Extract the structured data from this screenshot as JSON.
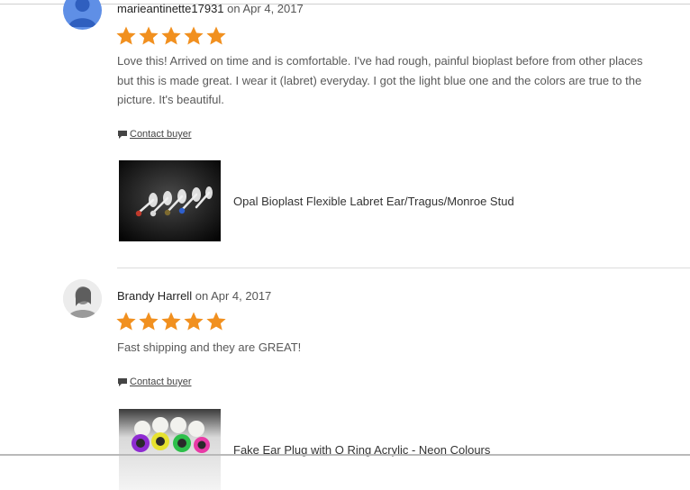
{
  "colors": {
    "star": "#f1901f",
    "avatar_blue": "#5f8fe6",
    "divider": "#dcdcdc"
  },
  "reviews": [
    {
      "author": "marieantinette17931",
      "date_text": "on Apr 4, 2017",
      "rating": 5,
      "text": "Love this! Arrived on time and is comfortable. I've had rough, painful bioplast before from other places but this is made great. I wear it (labret) everyday. I got the light blue one and the colors are true to the picture. It's beautiful.",
      "contact_label": "Contact buyer",
      "product_title": "Opal Bioplast Flexible Labret Ear/Tragus/Monroe Stud",
      "avatar_icon": "default-user-icon",
      "thumb_icon": "labret-studs-photo"
    },
    {
      "author": "Brandy Harrell",
      "date_text": "on Apr 4, 2017",
      "rating": 5,
      "text": "Fast shipping and they are GREAT!",
      "contact_label": "Contact buyer",
      "product_title": "Fake Ear Plug with O Ring Acrylic - Neon Colours",
      "avatar_icon": "profile-photo",
      "thumb_icon": "ear-plugs-photo"
    }
  ]
}
